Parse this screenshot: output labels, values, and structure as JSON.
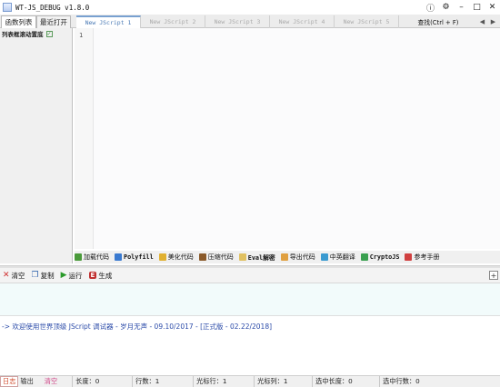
{
  "window": {
    "title": "WT-JS_DEBUG v1.8.0",
    "controls": [
      "ⓘ",
      "⚙",
      "–",
      "□",
      "✕"
    ]
  },
  "left_tabs": [
    "函数列表",
    "最近打开"
  ],
  "left_panel": {
    "scroll_label": "列表框滚动置底",
    "scroll_checked": true
  },
  "doc_tabs": [
    "New JScript 1",
    "New JScript 2",
    "New JScript 3",
    "New JScript 4",
    "New JScript 5"
  ],
  "find_button": "查找(Ctrl + F)",
  "editor": {
    "line_numbers": [
      "1"
    ]
  },
  "tools": [
    {
      "label": "加载代码",
      "icon": "load-code-icon",
      "color": "#4a9a3a"
    },
    {
      "label": "Polyfill",
      "icon": "polyfill-icon",
      "color": "#3a7ad0"
    },
    {
      "label": "美化代码",
      "icon": "beautify-icon",
      "color": "#e0b030"
    },
    {
      "label": "压缩代码",
      "icon": "compress-icon",
      "color": "#8a5a2a"
    },
    {
      "label": "Eval解密",
      "icon": "eval-decrypt-icon",
      "color": "#e0c060"
    },
    {
      "label": "导出代码",
      "icon": "export-code-icon",
      "color": "#e0a040"
    },
    {
      "label": "中英翻译",
      "icon": "translate-icon",
      "color": "#3a9ad0"
    },
    {
      "label": "CryptoJS",
      "icon": "cryptojs-icon",
      "color": "#3aa050"
    },
    {
      "label": "参考手册",
      "icon": "manual-icon",
      "color": "#d04040"
    }
  ],
  "actions": [
    {
      "label": "清空",
      "icon": "clear-icon"
    },
    {
      "label": "复制",
      "icon": "copy-icon"
    },
    {
      "label": "运行",
      "icon": "run-icon"
    },
    {
      "label": "生成",
      "icon": "generate-icon"
    }
  ],
  "output": {
    "message": "-> 欢迎使用世界顶级 JScript 调试器 - 岁月无声 - 09.10/2017 - [正式版 - 02.22/2018]"
  },
  "status": {
    "log_tab": "日志",
    "output_tab": "输出",
    "clear": "清空",
    "fields": [
      "长度：0",
      "行数：1",
      "光标行：1",
      "光标列：1",
      "选中长度：0",
      "选中行数：0"
    ]
  },
  "colors": {
    "active_tab_text": "#4a7ab5",
    "input_area_bg": "#f2fbfb",
    "output_text": "#2a4aa8"
  }
}
